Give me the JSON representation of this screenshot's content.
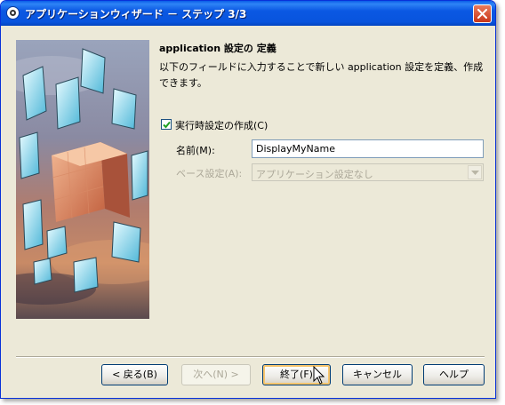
{
  "window": {
    "title": "アプリケーションウィザード － ステップ 3/3"
  },
  "content": {
    "heading": "application 設定の 定義",
    "description": "以下のフィールドに入力することで新しい application 設定を定義、作成できます。",
    "create_runtime_checkbox": {
      "label": "実行時設定の作成(C)",
      "checked": true
    },
    "name_field": {
      "label": "名前(M):",
      "value": "DisplayMyName"
    },
    "base_settings": {
      "label": "ベース設定(A):",
      "value": "アプリケーション設定なし",
      "enabled": false
    }
  },
  "buttons": {
    "back": "< 戻る(B)",
    "next": "次へ(N) >",
    "finish": "終了(F)",
    "cancel": "キャンセル",
    "help": "ヘルプ"
  },
  "colors": {
    "titlebar": "#0a5de7",
    "dialog_bg": "#ece9d8",
    "close_button": "#d9542e"
  },
  "icons": {
    "title_icon": "java-app-icon",
    "close": "close-icon",
    "check": "checkmark-icon",
    "dropdown": "chevron-down-icon",
    "cursor": "mouse-pointer-icon"
  }
}
